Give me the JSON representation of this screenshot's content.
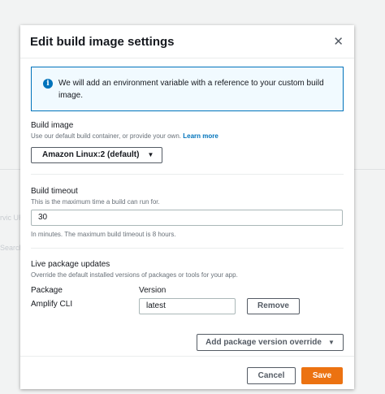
{
  "background": {
    "fragment_1": "rvic URL",
    "fragment_2": "Search"
  },
  "modal": {
    "title": "Edit build image settings",
    "info_text": "We will add an environment variable with a reference to your custom build image.",
    "build_image": {
      "label": "Build image",
      "description": "Use our default build container, or provide your own.",
      "link": "Learn more",
      "selected": "Amazon Linux:2 (default)"
    },
    "build_timeout": {
      "label": "Build timeout",
      "description": "This is the maximum time a build can run for.",
      "value": "30",
      "hint": "In minutes. The maximum build timeout is 8 hours."
    },
    "live_updates": {
      "label": "Live package updates",
      "description": "Override the default installed versions of packages or tools for your app.",
      "col_package": "Package",
      "col_version": "Version",
      "rows": [
        {
          "package": "Amplify CLI",
          "version": "latest",
          "remove": "Remove"
        }
      ],
      "add_override": "Add package version override"
    },
    "footer": {
      "cancel": "Cancel",
      "save": "Save"
    }
  },
  "colors": {
    "primary": "#ec7211",
    "info_border": "#0073bb",
    "link": "#0073bb"
  }
}
